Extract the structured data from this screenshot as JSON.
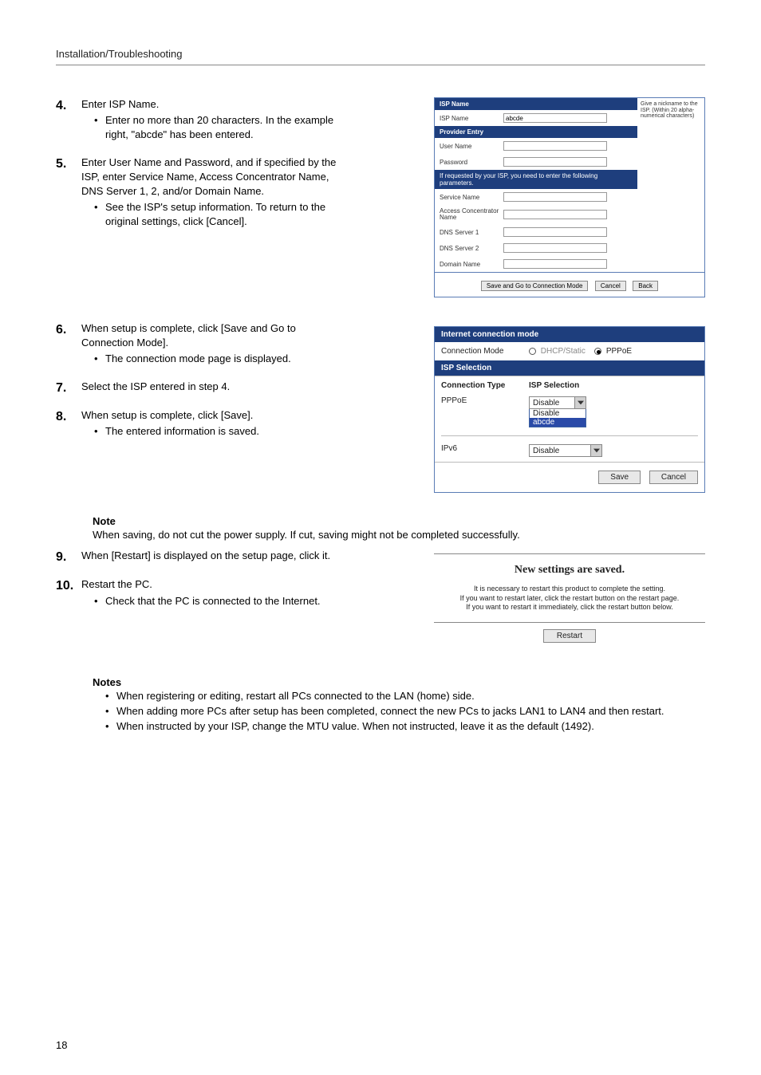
{
  "header": "Installation/Troubleshooting",
  "page_number": "18",
  "steps": {
    "s4": {
      "num": "4.",
      "title": "Enter ISP Name.",
      "b1": "Enter no more than 20 characters. In the example right, \"abcde\" has been entered."
    },
    "s5": {
      "num": "5.",
      "title": "Enter User Name and Password, and if specified by the ISP, enter Service Name, Access Concentrator Name, DNS Server 1, 2, and/or Domain Name.",
      "b1": "See the ISP's setup information. To return to the original settings, click [Cancel]."
    },
    "s6": {
      "num": "6.",
      "title": "When setup is complete, click [Save and Go to Connection Mode].",
      "b1": "The connection mode page is displayed."
    },
    "s7": {
      "num": "7.",
      "title": "Select the ISP entered in step 4."
    },
    "s8": {
      "num": "8.",
      "title": "When setup is complete, click [Save].",
      "b1": "The entered information is saved."
    },
    "s9": {
      "num": "9.",
      "title": "When [Restart] is displayed on the setup page, click it."
    },
    "s10": {
      "num": "10.",
      "title": "Restart the PC.",
      "b1": "Check that the PC is connected to the Internet."
    }
  },
  "note": {
    "heading": "Note",
    "text": "When saving, do not cut the power supply. If cut, saving might not be completed successfully."
  },
  "notes": {
    "heading": "Notes",
    "n1": "When registering or editing, restart all PCs connected to the LAN (home) side.",
    "n2": "When adding more PCs after setup has been completed, connect the new PCs to jacks LAN1 to LAN4 and then restart.",
    "n3": "When instructed by your ISP, change the MTU value. When not instructed, leave it as the default (1492)."
  },
  "isp_panel": {
    "side_note": "Give a nickname to the ISP. (Within 20 alpha-numerical characters)",
    "bar1": "ISP Name",
    "isp_name_label": "ISP Name",
    "isp_name_value": "abcde",
    "bar2": "Provider Entry",
    "user_label": "User Name",
    "pass_label": "Password",
    "bar3": "If requested by your ISP, you need to enter the following parameters.",
    "service_label": "Service Name",
    "ac_label": "Access Concentrator Name",
    "dns1_label": "DNS Server 1",
    "dns2_label": "DNS Server 2",
    "domain_label": "Domain Name",
    "btn_save": "Save and Go to Connection Mode",
    "btn_cancel": "Cancel",
    "btn_back": "Back"
  },
  "conn_panel": {
    "bar1": "Internet connection mode",
    "mode_label": "Connection Mode",
    "radio1": "DHCP/Static",
    "radio2": "PPPoE",
    "bar2": "ISP Selection",
    "th1": "Connection Type",
    "th2": "ISP Selection",
    "row1_label": "PPPoE",
    "dd1_value": "Disable",
    "dd1_opt1": "Disable",
    "dd1_opt2": "abcde",
    "row2_label": "IPv6",
    "dd2_value": "Disable",
    "btn_save": "Save",
    "btn_cancel": "Cancel"
  },
  "restart_panel": {
    "title": "New settings are saved.",
    "l1": "It is necessary to restart this product to complete the setting.",
    "l2": "If you want to restart later, click the restart button on the restart page.",
    "l3": "If you want to restart it immediately, click the restart button below.",
    "btn": "Restart"
  }
}
